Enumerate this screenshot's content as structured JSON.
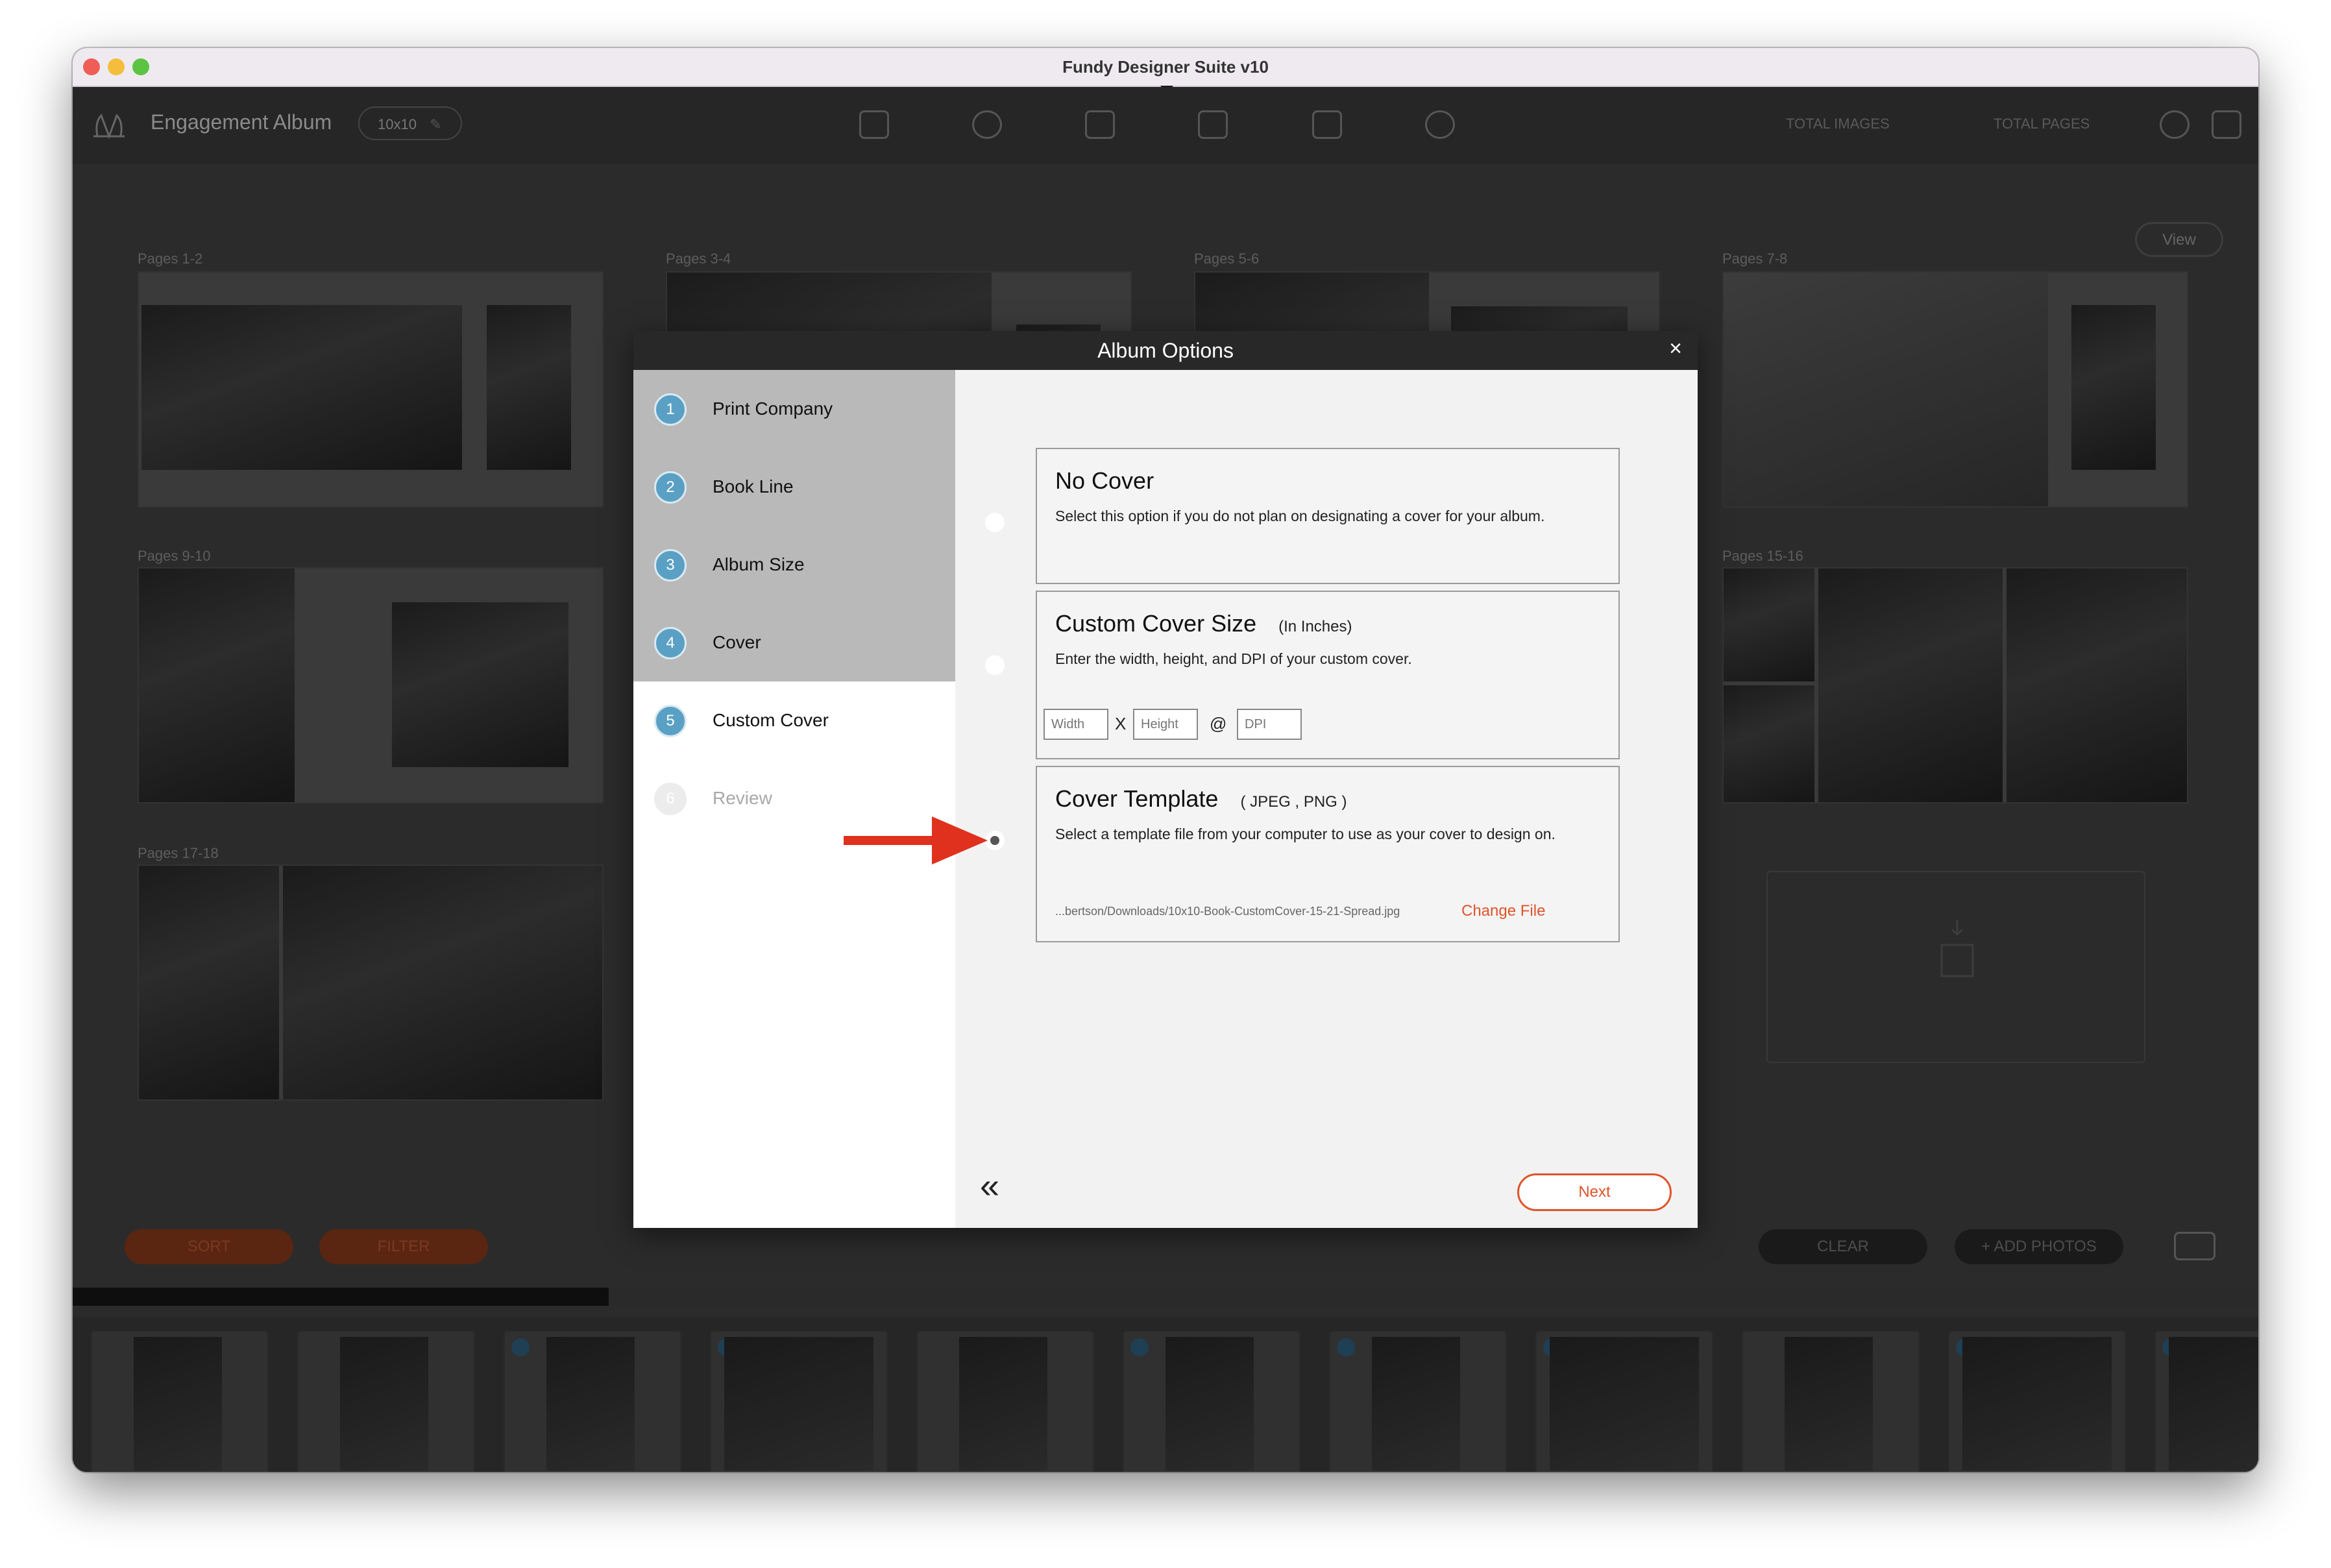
{
  "window": {
    "title": "Fundy Designer Suite v10"
  },
  "app": {
    "album_name": "Engagement Album",
    "album_size": "10x10",
    "stats": {
      "total_images": "TOTAL IMAGES",
      "total_pages": "TOTAL PAGES"
    },
    "view_label": "View",
    "spreads": [
      {
        "label": "Pages 1-2"
      },
      {
        "label": "Pages 3-4"
      },
      {
        "label": "Pages 5-6"
      },
      {
        "label": "Pages 7-8"
      },
      {
        "label": "Pages 9-10"
      },
      {
        "label": "Pages 15-16"
      },
      {
        "label": "Pages 17-18"
      }
    ],
    "toolbar": {
      "sort": "SORT",
      "filter": "FILTER",
      "clear": "CLEAR",
      "add_photos": "+ ADD PHOTOS"
    },
    "filmstrip": {
      "stars": "☆☆☆☆☆",
      "heart": "♡"
    }
  },
  "dialog": {
    "title": "Album Options",
    "close": "×",
    "steps": [
      {
        "number": "1",
        "label": "Print Company"
      },
      {
        "number": "2",
        "label": "Book Line"
      },
      {
        "number": "3",
        "label": "Album Size"
      },
      {
        "number": "4",
        "label": "Cover"
      },
      {
        "number": "5",
        "label": "Custom Cover"
      },
      {
        "number": "6",
        "label": "Review"
      }
    ],
    "options": {
      "no_cover": {
        "title": "No Cover",
        "description": "Select this option if you do not plan on designating a cover for your album."
      },
      "custom_size": {
        "title": "Custom Cover Size",
        "subtitle": "(In Inches)",
        "description": "Enter the width, height, and DPI of your custom cover.",
        "width_placeholder": "Width",
        "height_placeholder": "Height",
        "dpi_placeholder": "DPI",
        "x": "X",
        "at": "@"
      },
      "template": {
        "title": "Cover Template",
        "subtitle": "( JPEG , PNG )",
        "description": "Select a template file from your computer to use as your cover to design on.",
        "file_path": "...bertson/Downloads/10x10-Book-CustomCover-15-21-Spread.jpg",
        "change_file": "Change File",
        "selected": true
      }
    },
    "back_icon": "«",
    "next_label": "Next"
  },
  "colors": {
    "accent": "#e0532b",
    "step_blue": "#5aa0c4",
    "arrow_red": "#e0301e"
  }
}
